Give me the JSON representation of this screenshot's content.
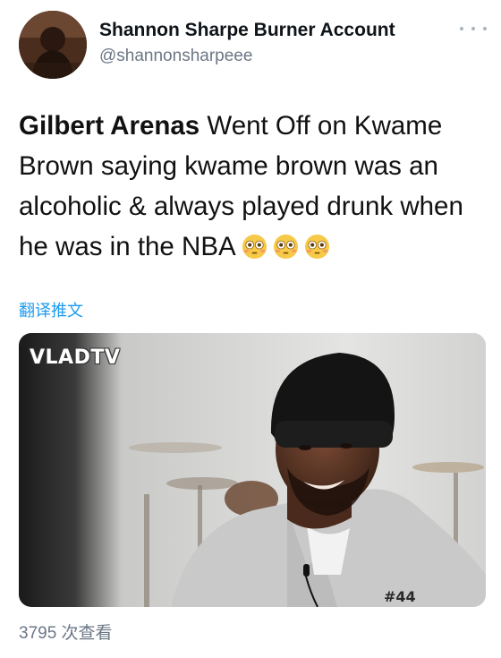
{
  "author": {
    "display_name": "Shannon Sharpe Burner Account",
    "handle": "@shannonsharpeee"
  },
  "tweet": {
    "bold_name": "Gilbert Arenas",
    "text": " Went Off on Kwame Brown saying kwame brown was an alcoholic & always played drunk when he was in the NBA ",
    "emoji_icons": [
      "flushed-face-icon",
      "flushed-face-icon",
      "flushed-face-icon"
    ]
  },
  "translate_label": "翻译推文",
  "media": {
    "watermark": "VLADTV",
    "shirt_logo": "#44"
  },
  "views_label": "3795 次查看",
  "colors": {
    "link": "#1d9bf0",
    "secondary_text": "#6b7785",
    "emoji_face": "#f7c948"
  }
}
